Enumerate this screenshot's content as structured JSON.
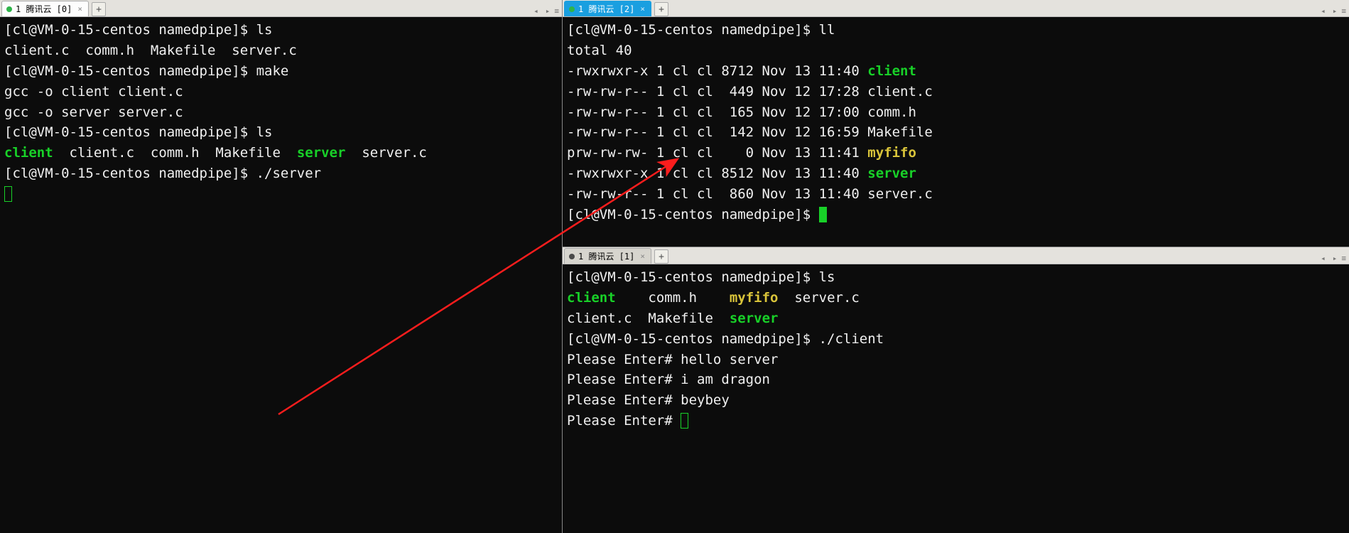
{
  "tabs": {
    "left": {
      "label": "1 腾讯云 [0]"
    },
    "rightTop": {
      "label": "1 腾讯云 [2]"
    },
    "rightBot": {
      "label": "1 腾讯云 [1]"
    }
  },
  "prompt": "[cl@VM-0-15-centos namedpipe]$ ",
  "left_terminal": {
    "cmd_ls1": "ls",
    "ls1_out": "client.c  comm.h  Makefile  server.c",
    "cmd_make": "make",
    "make_out1": "gcc -o client client.c",
    "make_out2": "gcc -o server server.c",
    "cmd_ls2": "ls",
    "ls2_client": "client",
    "ls2_mid": "  client.c  comm.h  Makefile  ",
    "ls2_server": "server",
    "ls2_tail": "  server.c",
    "cmd_server": "./server"
  },
  "right_top_terminal": {
    "cmd_ll": "ll",
    "total": "total 40",
    "rows": [
      {
        "perm": "-rwxrwxr-x 1 cl cl 8712 Nov 13 11:40 ",
        "name": "client",
        "cls": "green"
      },
      {
        "perm": "-rw-rw-r-- 1 cl cl  449 Nov 12 17:28 ",
        "name": "client.c",
        "cls": "norm"
      },
      {
        "perm": "-rw-rw-r-- 1 cl cl  165 Nov 12 17:00 ",
        "name": "comm.h",
        "cls": "norm"
      },
      {
        "perm": "-rw-rw-r-- 1 cl cl  142 Nov 12 16:59 ",
        "name": "Makefile",
        "cls": "norm"
      },
      {
        "perm": "prw-rw-rw- 1 cl cl    0 Nov 13 11:41 ",
        "name": "myfifo",
        "cls": "yellow"
      },
      {
        "perm": "-rwxrwxr-x 1 cl cl 8512 Nov 13 11:40 ",
        "name": "server",
        "cls": "green"
      },
      {
        "perm": "-rw-rw-r-- 1 cl cl  860 Nov 13 11:40 ",
        "name": "server.c",
        "cls": "norm"
      }
    ]
  },
  "right_bot_terminal": {
    "cmd_ls": "ls",
    "ls_client": "client",
    "ls_sp1": "    ",
    "ls_commh": "comm.h",
    "ls_sp2": "    ",
    "ls_myfifo": "myfifo",
    "ls_sp3": "  ",
    "ls_serverc": "server.c",
    "ls_clientc": "client.c",
    "ls_sp4": "  ",
    "ls_makefile": "Makefile",
    "ls_sp5": "  ",
    "ls_server": "server",
    "cmd_client": "./client",
    "enter_prefix": "Please Enter# ",
    "line1": "hello server",
    "line2": "i am dragon",
    "line3": "beybey"
  }
}
